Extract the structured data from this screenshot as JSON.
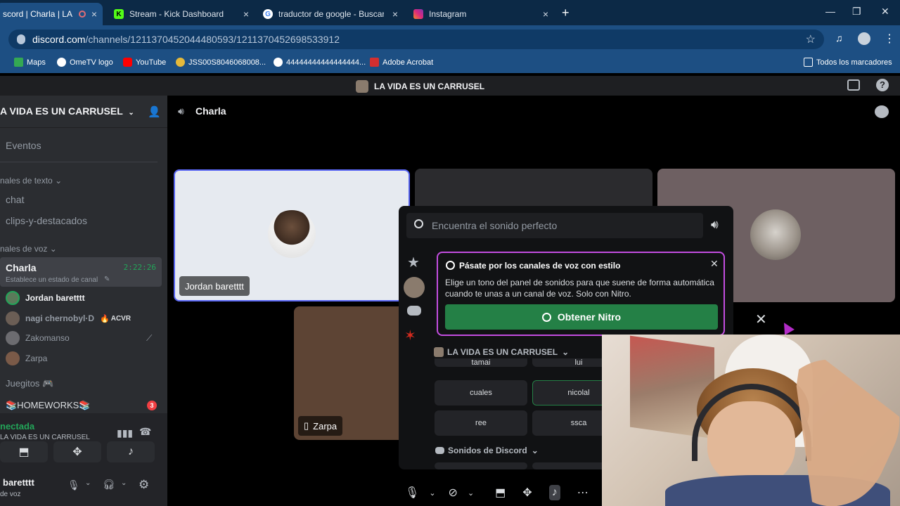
{
  "browser": {
    "tabs": [
      {
        "label": "scord | Charla | LA VI",
        "close": "×"
      },
      {
        "label": "Stream - Kick Dashboard",
        "close": "×"
      },
      {
        "label": "traductor de google - Buscar c",
        "close": "×"
      },
      {
        "label": "Instagram",
        "close": "×"
      }
    ],
    "new_tab": "+",
    "window_min": "—",
    "window_max": "❐",
    "window_close": "✕",
    "url_host": "discord.com",
    "url_path": "/channels/1211370452044480593/1211370452698533912",
    "bookmarks": [
      {
        "label": "Maps"
      },
      {
        "label": "OmeTV logo"
      },
      {
        "label": "YouTube"
      },
      {
        "label": "JSS00S8046068008..."
      },
      {
        "label": "44444444444444444..."
      },
      {
        "label": "Adobe Acrobat"
      }
    ],
    "all_bookmarks": "Todos los marcadores"
  },
  "discord": {
    "window_title": "LA VIDA ES UN CARRUSEL",
    "server_name": "A VIDA ES UN CARRUSEL",
    "events": "Eventos",
    "text_category": "nales de texto",
    "text_channels": [
      "chat",
      "clips-y-destacados"
    ],
    "voice_category": "nales de voz",
    "active_voice": {
      "name": "Charla",
      "timer": "2:22:26",
      "status": "Establece un estado de canal"
    },
    "voice_users": [
      {
        "name": "Jordan baretttt",
        "color": "#5b7a5a"
      },
      {
        "name": "nagi chernobyl·D",
        "badge": "ACVR",
        "color": "#6b5e55"
      },
      {
        "name": "Zakomanso",
        "color": "#6c6c70"
      },
      {
        "name": "Zarpa",
        "color": "#7a5a48"
      }
    ],
    "channel_juegitos": "Juegitos 🎮",
    "channel_homeworks": "📚HOMEWORKS📚",
    "homeworks_badge": "3",
    "voice_connected": "nectada",
    "voice_connected_server": "LA VIDA ES UN CARRUSEL",
    "user_name": "baretttt",
    "user_status": "de voz",
    "header_channel": "Charla",
    "tiles": {
      "jordan": "Jordan baretttt",
      "zarpa": "Zarpa"
    }
  },
  "soundboard": {
    "search_placeholder": "Encuentra el sonido perfecto",
    "nitro_title": "Pásate por los canales de voz con estilo",
    "nitro_body": "Elige un tono del panel de sonidos para que suene de forma automática cuando te unas a un canal de voz. Solo con Nitro.",
    "nitro_button": "Obtener Nitro",
    "server_section": "LA VIDA ES UN CARRUSEL",
    "sounds_partial": [
      "tamai",
      "lui"
    ],
    "sounds": [
      "cuales",
      "nicolal",
      "ree",
      "ssca"
    ],
    "discord_section": "Sonidos de Discord"
  },
  "colors": {
    "accent_green": "#248046",
    "nitro_border": "#c34de0",
    "browser_tab": "#1d4f83",
    "selected_tile_border": "#5865f2"
  }
}
